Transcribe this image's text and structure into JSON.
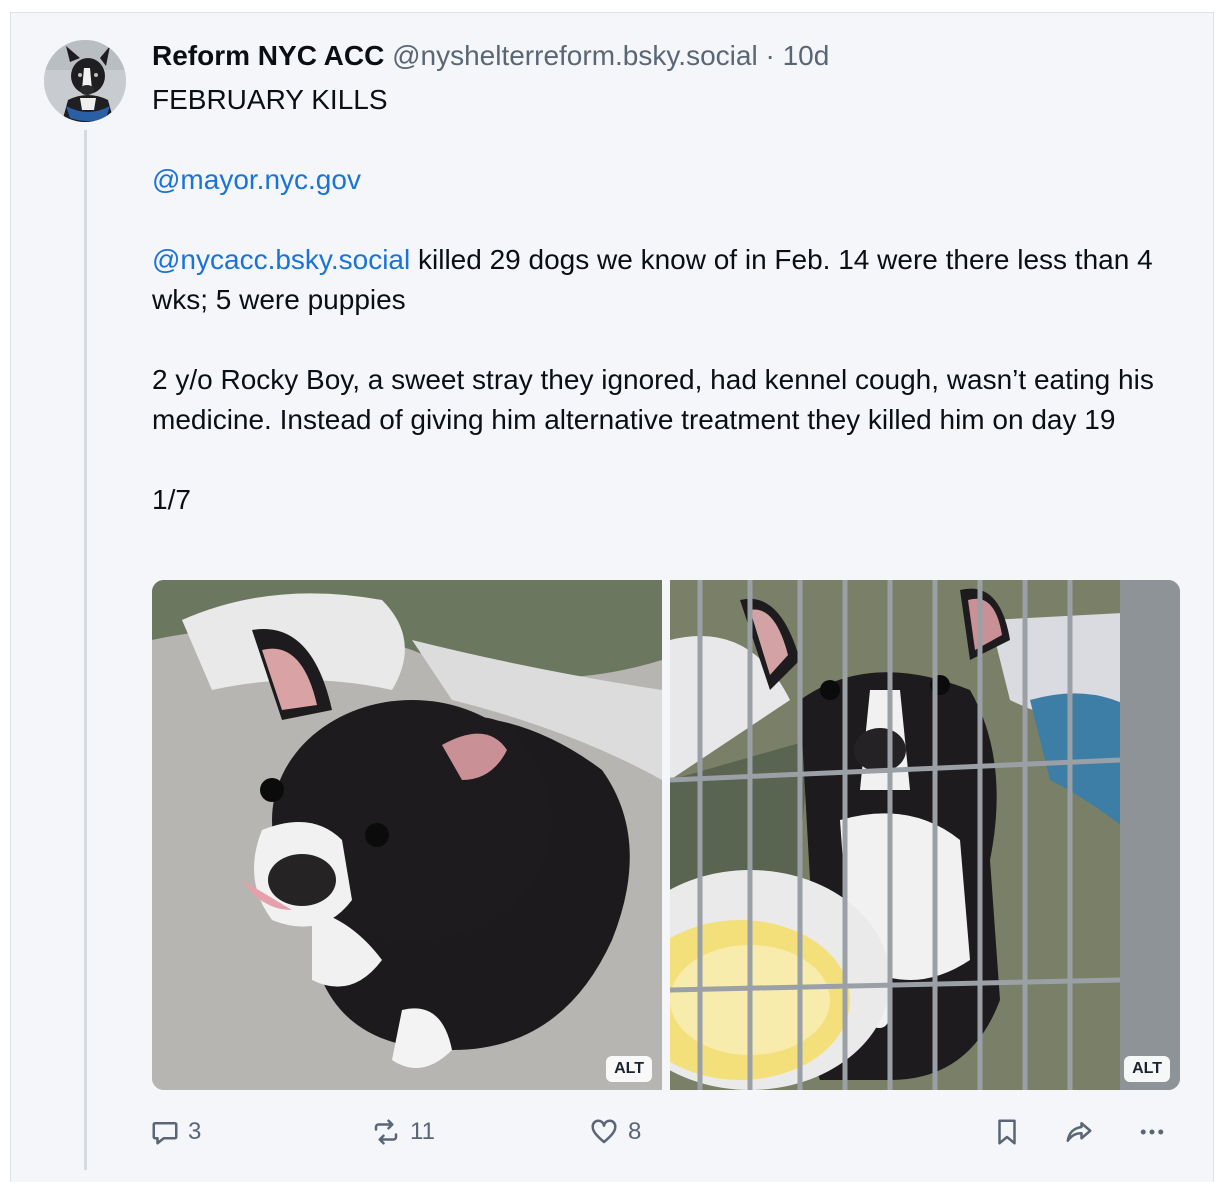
{
  "post": {
    "author_name": "Reform NYC ACC",
    "author_handle": "@nyshelterreform.bsky.social",
    "separator": "·",
    "time": "10d",
    "lines": {
      "title": "FEBRUARY KILLS",
      "mention1": "@mayor.nyc.gov",
      "mention2": "@nycacc.bsky.social",
      "para2_rest": " killed 29 dogs we know of in Feb. 14 were there less than 4 wks; 5 were puppies",
      "para3": "2 y/o Rocky Boy, a sweet stray they ignored, had kennel cough, wasn’t eating his medicine. Instead of giving him alternative treatment they killed him on day 19",
      "counter": "1/7"
    },
    "media": [
      {
        "alt_badge": "ALT"
      },
      {
        "alt_badge": "ALT"
      }
    ],
    "actions": {
      "reply_icon": "reply-icon",
      "reply_count": "3",
      "repost_icon": "repost-icon",
      "repost_count": "11",
      "like_icon": "heart-icon",
      "like_count": "8",
      "bookmark_icon": "bookmark-icon",
      "share_icon": "share-icon",
      "more_icon": "more-icon"
    }
  },
  "colors": {
    "mention": "#1a73d9",
    "muted": "#5a6675",
    "background": "#f4f6f9"
  }
}
